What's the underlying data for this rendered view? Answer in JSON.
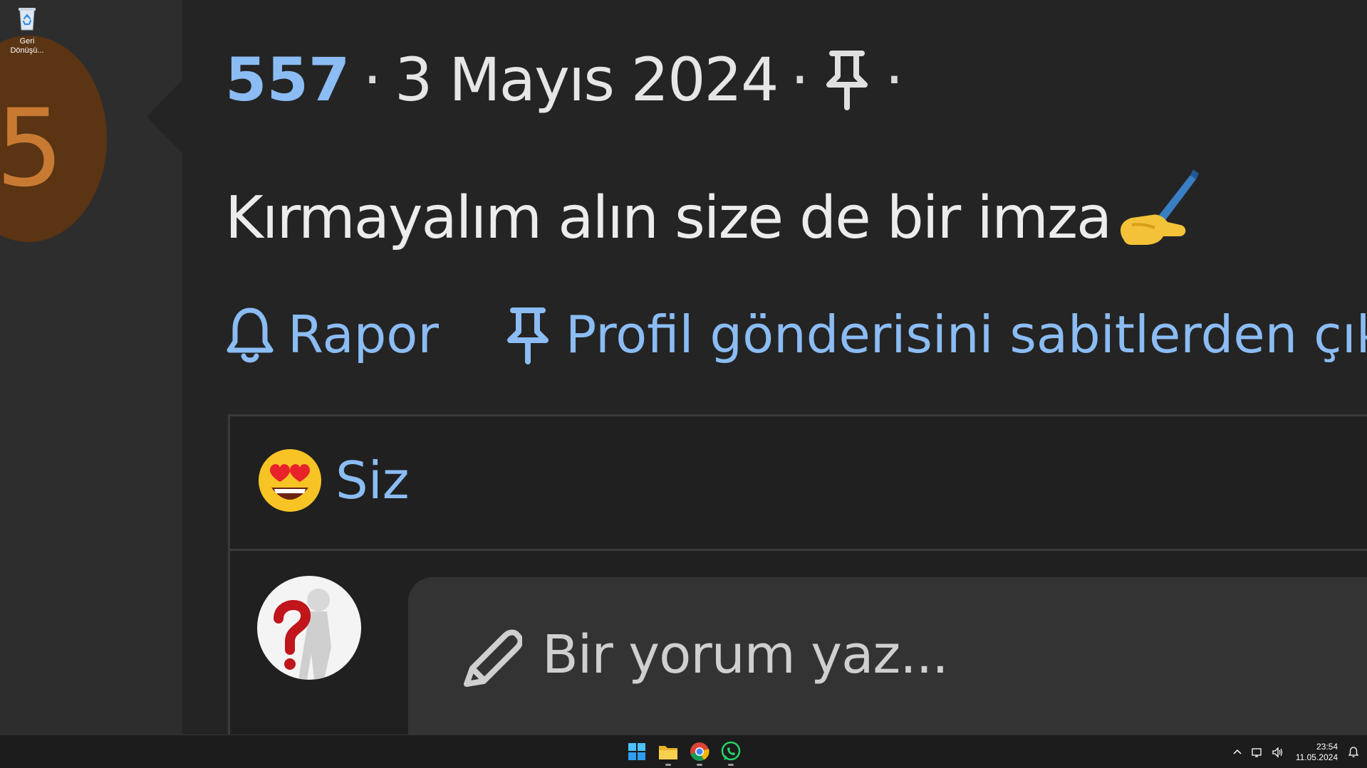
{
  "desktop": {
    "recycle_bin_label_line1": "Geri",
    "recycle_bin_label_line2": "Dönüşü...",
    "profile_avatar_letter": "5"
  },
  "post": {
    "number": "557",
    "separator": "·",
    "date": "3 Mayıs 2024",
    "text": "Kırmayalım alın size de bir imza",
    "text_emoji": "writing-hand-icon",
    "actions": {
      "report_label": "Rapor",
      "unpin_label": "Profil gönderisini sabitlerden çıka"
    },
    "reactions": {
      "emoji": "heart-eyes-icon",
      "label": "Siz"
    },
    "comment": {
      "placeholder": "Bir yorum yaz..."
    }
  },
  "taskbar": {
    "apps": [
      "windows-start",
      "file-explorer",
      "chrome",
      "whatsapp"
    ],
    "time": "23:54",
    "date": "11.05.2024"
  },
  "colors": {
    "accent_blue": "#8bbcf4",
    "panel_bg": "#242424",
    "avatar_orange": "#5a3413"
  }
}
